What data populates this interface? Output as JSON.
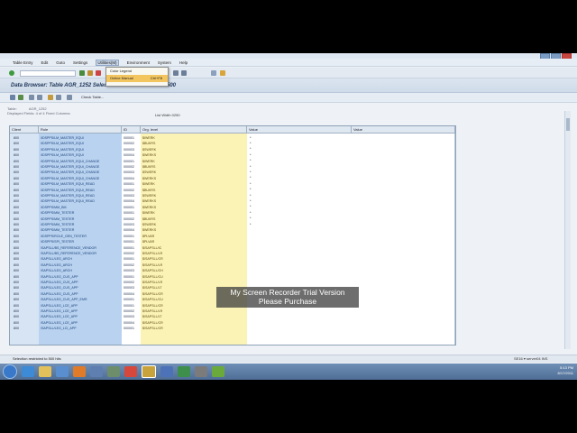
{
  "menu": [
    "Table Entry",
    "Edit",
    "Goto",
    "Settings",
    "Utilities(M)",
    "Environment",
    "System",
    "Help"
  ],
  "menu_active_index": 4,
  "dropdown": {
    "items": [
      {
        "label": "Color Legend"
      },
      {
        "label": "Online Manual",
        "shortcut": "Ctrl+F8"
      }
    ],
    "selected": 1
  },
  "header": {
    "title": "Data Browser: Table AGR_1252 Select Entries",
    "count": "500"
  },
  "app_toolbar": {
    "check_table": "Check Table..."
  },
  "info": {
    "line1": "Table:",
    "table": "AGR_1252",
    "line2": "Displayed Fields:  4  of  4  Fixed Columns:"
  },
  "list_btn": "List Width 0250",
  "columns": [
    "Client",
    "Role",
    "ID",
    "Org. level",
    "Value",
    "Value"
  ],
  "rows": [
    {
      "client": "800",
      "role": "/IDSPPS/LM_MASTER_EQUI",
      "id": "000001",
      "org": "$IWERK"
    },
    {
      "client": "800",
      "role": "/IDSPPS/LM_MASTER_EQUI",
      "id": "000002",
      "org": "$BUKRS"
    },
    {
      "client": "800",
      "role": "/IDSPPS/LM_MASTER_EQUI",
      "id": "000003",
      "org": "$SWERK"
    },
    {
      "client": "800",
      "role": "/IDSPPS/LM_MASTER_EQUI",
      "id": "000004",
      "org": "$WERKS"
    },
    {
      "client": "800",
      "role": "/IDSPPS/LM_MASTER_EQUI_CHANGE",
      "id": "000001",
      "org": "$IWERK"
    },
    {
      "client": "800",
      "role": "/IDSPPS/LM_MASTER_EQUI_CHANGE",
      "id": "000002",
      "org": "$BUKRS"
    },
    {
      "client": "800",
      "role": "/IDSPPS/LM_MASTER_EQUI_CHANGE",
      "id": "000003",
      "org": "$SWERK"
    },
    {
      "client": "800",
      "role": "/IDSPPS/LM_MASTER_EQUI_CHANGE",
      "id": "000004",
      "org": "$WERKS"
    },
    {
      "client": "800",
      "role": "/IDSPPS/LM_MASTER_EQUI_READ",
      "id": "000001",
      "org": "$IWERK"
    },
    {
      "client": "800",
      "role": "/IDSPPS/LM_MASTER_EQUI_READ",
      "id": "000002",
      "org": "$BUKRS"
    },
    {
      "client": "800",
      "role": "/IDSPPS/LM_MASTER_EQUI_READ",
      "id": "000003",
      "org": "$SWERK"
    },
    {
      "client": "800",
      "role": "/IDSPPS/LM_MASTER_EQUI_READ",
      "id": "000004",
      "org": "$WERKS"
    },
    {
      "client": "800",
      "role": "/IDSPPS/MM_BM",
      "id": "000001",
      "org": "$WERKS"
    },
    {
      "client": "800",
      "role": "/IDSPPS/MM_TESTER",
      "id": "000001",
      "org": "$IWERK"
    },
    {
      "client": "800",
      "role": "/IDSPPS/MM_TESTER",
      "id": "000002",
      "org": "$BUKRS"
    },
    {
      "client": "800",
      "role": "/IDSPPS/MM_TESTER",
      "id": "000003",
      "org": "$SWERK"
    },
    {
      "client": "800",
      "role": "/IDSPPS/MM_TESTER",
      "id": "000004",
      "org": "$WERKS"
    },
    {
      "client": "800",
      "role": "/IDSPPS/ROLE_GEN_TESTER",
      "id": "000001",
      "org": "$PLVAR"
    },
    {
      "client": "800",
      "role": "/IDSPPS/SPI_TESTER",
      "id": "000001",
      "org": "$PLVAR"
    },
    {
      "client": "800",
      "role": "/SAPSLL/BS_REFERENCE_VENDOR",
      "id": "000001",
      "org": "$/SAPSLL/IC"
    },
    {
      "client": "800",
      "role": "/SAPSLL/BS_REFERENCE_VENDOR",
      "id": "000002",
      "org": "$/SAPSLL/LR"
    },
    {
      "client": "800",
      "role": "/SAPSLL/LEG_ARCH",
      "id": "000001",
      "org": "$/SAPSLL/CR"
    },
    {
      "client": "800",
      "role": "/SAPSLL/LEG_ARCH",
      "id": "000002",
      "org": "$/SAPSLL/LR"
    },
    {
      "client": "800",
      "role": "/SAPSLL/LEG_ARCH",
      "id": "000003",
      "org": "$/SAPSLL/CH"
    },
    {
      "client": "800",
      "role": "/SAPSLL/LEG_CUS_APP",
      "id": "000001",
      "org": "$/SAPSLL/CU"
    },
    {
      "client": "800",
      "role": "/SAPSLL/LEG_CUS_APP",
      "id": "000002",
      "org": "$/SAPSLL/LR"
    },
    {
      "client": "800",
      "role": "/SAPSLL/LEG_CUS_APP",
      "id": "000003",
      "org": "$/SAPSLL/LT"
    },
    {
      "client": "800",
      "role": "/SAPSLL/LEG_CUS_APP",
      "id": "000004",
      "org": "$/SAPSLL/CR"
    },
    {
      "client": "800",
      "role": "/SAPSLL/LEG_CUS_APP_EMR",
      "id": "000001",
      "org": "$/SAPSLL/CU"
    },
    {
      "client": "800",
      "role": "/SAPSLL/LEG_LCE_APP",
      "id": "000001",
      "org": "$/SAPSLL/CR"
    },
    {
      "client": "800",
      "role": "/SAPSLL/LEG_LCE_APP",
      "id": "000002",
      "org": "$/SAPSLL/LR"
    },
    {
      "client": "800",
      "role": "/SAPSLL/LEG_LCE_APP",
      "id": "000003",
      "org": "$/SAPSLL/LT"
    },
    {
      "client": "800",
      "role": "/SAPSLL/LEG_LCE_APP",
      "id": "000004",
      "org": "$/SAPSLL/CR"
    },
    {
      "client": "800",
      "role": "/SAPSLL/LEG_LCI_APP",
      "id": "000001",
      "org": "$/SAPSLL/CR"
    }
  ],
  "value_dots_rows": 16,
  "value_dot": "*",
  "status": {
    "message": "Selection restricted to 500 hits",
    "right": "SE16  ▾  server04  INS"
  },
  "watermark": {
    "line1": "My Screen Recorder Trial Version",
    "line2": "Please Purchase"
  },
  "tray": {
    "time": "5:13 PM",
    "date": "8/17/2011"
  },
  "colors": {
    "role_col": "#b8d2ef",
    "org_col": "#fbf2b5",
    "client_col": "#d7e4f3"
  }
}
